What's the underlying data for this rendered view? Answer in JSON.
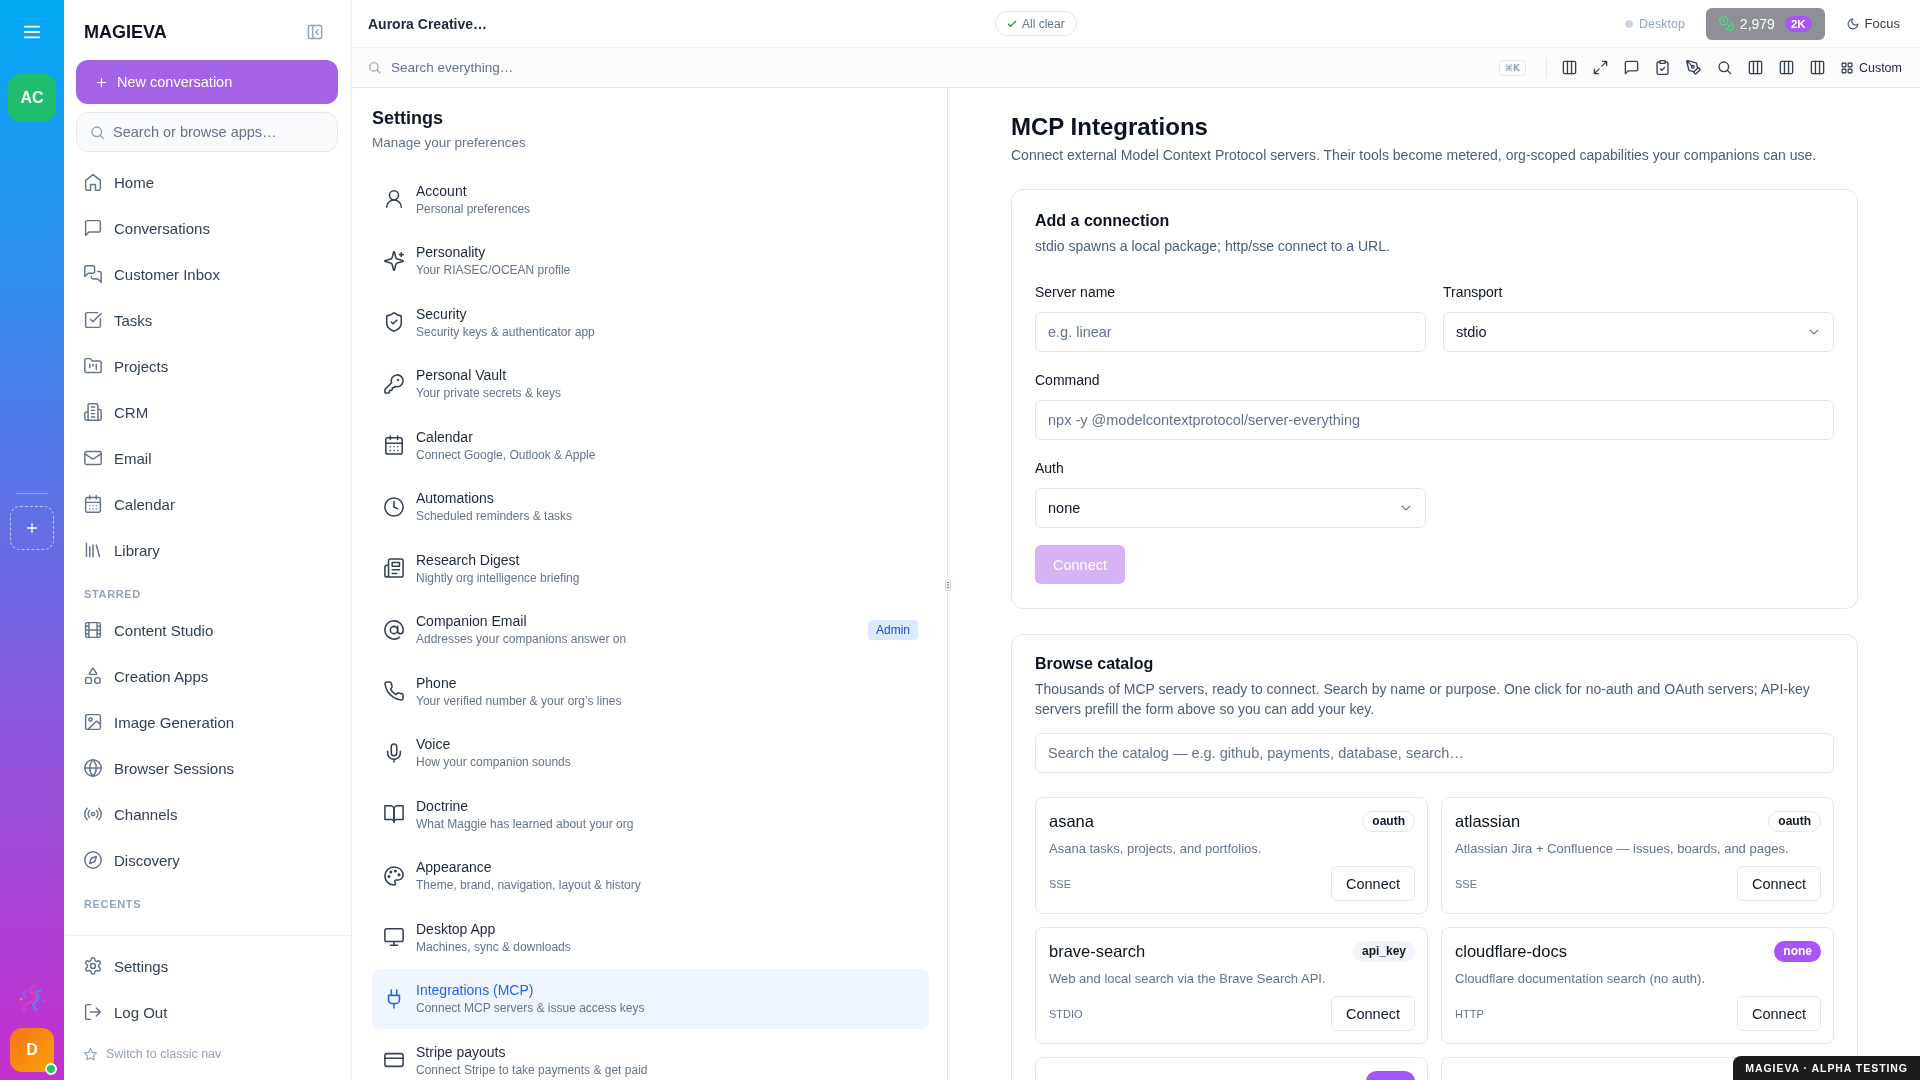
{
  "rail": {
    "workspace": "AC",
    "user": {
      "initial": "D",
      "online": true
    }
  },
  "sidebar": {
    "brand": "MAGIEVA",
    "new_conversation": "New conversation",
    "search": {
      "placeholder": "Search or browse apps…"
    },
    "items": [
      {
        "label": "Home"
      },
      {
        "label": "Conversations"
      },
      {
        "label": "Customer Inbox"
      },
      {
        "label": "Tasks"
      },
      {
        "label": "Projects"
      },
      {
        "label": "CRM"
      },
      {
        "label": "Email"
      },
      {
        "label": "Calendar"
      },
      {
        "label": "Library"
      }
    ],
    "starred": {
      "title": "STARRED",
      "items": [
        {
          "label": "Content Studio"
        },
        {
          "label": "Creation Apps"
        },
        {
          "label": "Image Generation"
        },
        {
          "label": "Browser Sessions"
        },
        {
          "label": "Channels"
        },
        {
          "label": "Discovery"
        }
      ]
    },
    "recents": {
      "title": "RECENTS"
    },
    "footer": {
      "items": [
        {
          "label": "Settings"
        },
        {
          "label": "Log Out"
        }
      ],
      "classic_nav": "Switch to classic nav"
    }
  },
  "topbar": {
    "title": "Aurora Creative…",
    "status": "All clear",
    "device": {
      "label": "Desktop",
      "online": false
    },
    "credits": {
      "amount": "2,979",
      "badge": "2K"
    },
    "focus": "Focus"
  },
  "toolbar": {
    "search": {
      "placeholder": "Search everything…"
    },
    "shortcut": "⌘K",
    "custom": "Custom"
  },
  "settings": {
    "title": "Settings",
    "subtitle": "Manage your preferences",
    "items": [
      {
        "title": "Account",
        "subtitle": "Personal preferences",
        "selected": false
      },
      {
        "title": "Personality",
        "subtitle": "Your RIASEC/OCEAN profile",
        "selected": false
      },
      {
        "title": "Security",
        "subtitle": "Security keys & authenticator app",
        "selected": false
      },
      {
        "title": "Personal Vault",
        "subtitle": "Your private secrets & keys",
        "selected": false
      },
      {
        "title": "Calendar",
        "subtitle": "Connect Google, Outlook & Apple",
        "selected": false
      },
      {
        "title": "Automations",
        "subtitle": "Scheduled reminders & tasks",
        "selected": false
      },
      {
        "title": "Research Digest",
        "subtitle": "Nightly org intelligence briefing",
        "selected": false
      },
      {
        "title": "Companion Email",
        "subtitle": "Addresses your companions answer on",
        "badge": "Admin",
        "selected": false
      },
      {
        "title": "Phone",
        "subtitle": "Your verified number & your org’s lines",
        "selected": false
      },
      {
        "title": "Voice",
        "subtitle": "How your companion sounds",
        "selected": false
      },
      {
        "title": "Doctrine",
        "subtitle": "What Maggie has learned about your org",
        "selected": false
      },
      {
        "title": "Appearance",
        "subtitle": "Theme, brand, navigation, layout & history",
        "selected": false
      },
      {
        "title": "Desktop App",
        "subtitle": "Machines, sync & downloads",
        "selected": false
      },
      {
        "title": "Integrations (MCP)",
        "subtitle": "Connect MCP servers & issue access keys",
        "selected": true
      },
      {
        "title": "Stripe payouts",
        "subtitle": "Connect Stripe to take payments & get paid",
        "selected": false
      }
    ]
  },
  "main": {
    "title": "MCP Integrations",
    "description": "Connect external Model Context Protocol servers. Their tools become metered, org-scoped capabilities your companions can use.",
    "connection": {
      "title": "Add a connection",
      "description": "stdio spawns a local package; http/sse connect to a URL.",
      "fields": [
        {
          "label": "Server name",
          "kind": "text",
          "placeholder": "e.g. linear",
          "wide": false
        },
        {
          "label": "Transport",
          "kind": "select",
          "value": "stdio",
          "wide": false
        },
        {
          "label": "Command",
          "kind": "text",
          "placeholder": "npx -y @modelcontextprotocol/server-everything",
          "wide": true
        },
        {
          "label": "Auth",
          "kind": "select",
          "value": "none",
          "wide": false
        }
      ],
      "submit": {
        "label": "Connect",
        "disabled": true
      }
    },
    "catalog": {
      "title": "Browse catalog",
      "description": "Thousands of MCP servers, ready to connect. Search by name or purpose. One click for no-auth and OAuth servers; API-key servers prefill the form above so you can add your key.",
      "search": {
        "placeholder": "Search the catalog — e.g. github, payments, database, search…"
      },
      "servers": [
        {
          "kind": "full",
          "name": "asana",
          "auth": {
            "label": "oauth",
            "kind": "outline"
          },
          "description": "Asana tasks, projects, and portfolios.",
          "transport": "SSE",
          "action": "Connect"
        },
        {
          "kind": "full",
          "name": "atlassian",
          "auth": {
            "label": "oauth",
            "kind": "outline"
          },
          "description": "Atlassian Jira + Confluence — issues, boards, and pages.",
          "transport": "SSE",
          "action": "Connect"
        },
        {
          "kind": "full",
          "name": "brave-search",
          "auth": {
            "label": "api_key",
            "kind": "muted"
          },
          "description": "Web and local search via the Brave Search API.",
          "transport": "STDIO",
          "action": "Connect"
        },
        {
          "kind": "full",
          "name": "cloudflare-docs",
          "auth": {
            "label": "none",
            "kind": "accent"
          },
          "description": "Cloudflare documentation search (no auth).",
          "transport": "HTTP",
          "action": "Connect"
        },
        {
          "kind": "partial",
          "auth": {
            "kind": "accent"
          }
        },
        {
          "kind": "partial"
        }
      ]
    }
  },
  "environment_badge": "MAGIEVA · ALPHA TESTING"
}
